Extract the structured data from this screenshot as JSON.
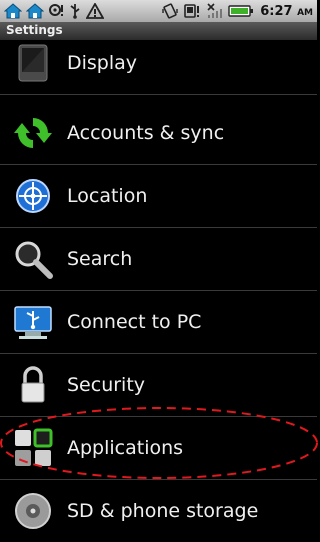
{
  "status_bar": {
    "time": "6:27",
    "ampm": "AM"
  },
  "title_bar": {
    "title": "Settings"
  },
  "settings": {
    "items": [
      {
        "label": "Display",
        "icon": "display-icon"
      },
      {
        "label": "Accounts & sync",
        "icon": "sync-icon"
      },
      {
        "label": "Location",
        "icon": "location-icon"
      },
      {
        "label": "Search",
        "icon": "search-icon"
      },
      {
        "label": "Connect to PC",
        "icon": "usb-icon"
      },
      {
        "label": "Security",
        "icon": "lock-icon"
      },
      {
        "label": "Applications",
        "icon": "applications-icon",
        "highlighted": true
      },
      {
        "label": "SD & phone storage",
        "icon": "storage-icon"
      }
    ]
  },
  "colors": {
    "highlight_annotation": "#e0191e",
    "sync_green": "#3fbf2a",
    "location_blue": "#1e6fd6"
  }
}
